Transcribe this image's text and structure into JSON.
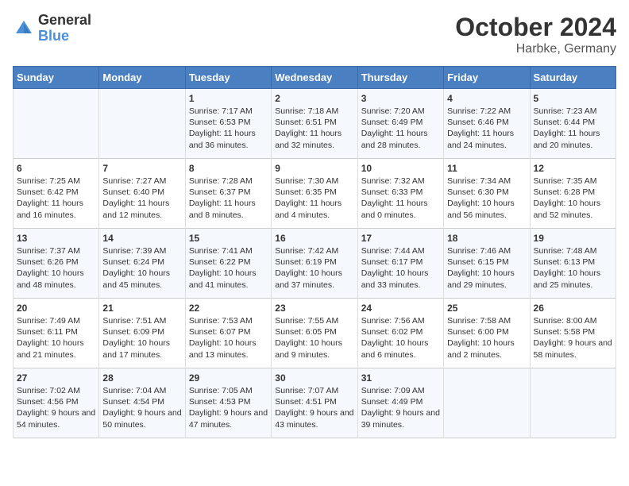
{
  "logo": {
    "general": "General",
    "blue": "Blue"
  },
  "title": "October 2024",
  "subtitle": "Harbke, Germany",
  "days_of_week": [
    "Sunday",
    "Monday",
    "Tuesday",
    "Wednesday",
    "Thursday",
    "Friday",
    "Saturday"
  ],
  "weeks": [
    [
      {
        "day": "",
        "sunrise": "",
        "sunset": "",
        "daylight": ""
      },
      {
        "day": "",
        "sunrise": "",
        "sunset": "",
        "daylight": ""
      },
      {
        "day": "1",
        "sunrise": "Sunrise: 7:17 AM",
        "sunset": "Sunset: 6:53 PM",
        "daylight": "Daylight: 11 hours and 36 minutes."
      },
      {
        "day": "2",
        "sunrise": "Sunrise: 7:18 AM",
        "sunset": "Sunset: 6:51 PM",
        "daylight": "Daylight: 11 hours and 32 minutes."
      },
      {
        "day": "3",
        "sunrise": "Sunrise: 7:20 AM",
        "sunset": "Sunset: 6:49 PM",
        "daylight": "Daylight: 11 hours and 28 minutes."
      },
      {
        "day": "4",
        "sunrise": "Sunrise: 7:22 AM",
        "sunset": "Sunset: 6:46 PM",
        "daylight": "Daylight: 11 hours and 24 minutes."
      },
      {
        "day": "5",
        "sunrise": "Sunrise: 7:23 AM",
        "sunset": "Sunset: 6:44 PM",
        "daylight": "Daylight: 11 hours and 20 minutes."
      }
    ],
    [
      {
        "day": "6",
        "sunrise": "Sunrise: 7:25 AM",
        "sunset": "Sunset: 6:42 PM",
        "daylight": "Daylight: 11 hours and 16 minutes."
      },
      {
        "day": "7",
        "sunrise": "Sunrise: 7:27 AM",
        "sunset": "Sunset: 6:40 PM",
        "daylight": "Daylight: 11 hours and 12 minutes."
      },
      {
        "day": "8",
        "sunrise": "Sunrise: 7:28 AM",
        "sunset": "Sunset: 6:37 PM",
        "daylight": "Daylight: 11 hours and 8 minutes."
      },
      {
        "day": "9",
        "sunrise": "Sunrise: 7:30 AM",
        "sunset": "Sunset: 6:35 PM",
        "daylight": "Daylight: 11 hours and 4 minutes."
      },
      {
        "day": "10",
        "sunrise": "Sunrise: 7:32 AM",
        "sunset": "Sunset: 6:33 PM",
        "daylight": "Daylight: 11 hours and 0 minutes."
      },
      {
        "day": "11",
        "sunrise": "Sunrise: 7:34 AM",
        "sunset": "Sunset: 6:30 PM",
        "daylight": "Daylight: 10 hours and 56 minutes."
      },
      {
        "day": "12",
        "sunrise": "Sunrise: 7:35 AM",
        "sunset": "Sunset: 6:28 PM",
        "daylight": "Daylight: 10 hours and 52 minutes."
      }
    ],
    [
      {
        "day": "13",
        "sunrise": "Sunrise: 7:37 AM",
        "sunset": "Sunset: 6:26 PM",
        "daylight": "Daylight: 10 hours and 48 minutes."
      },
      {
        "day": "14",
        "sunrise": "Sunrise: 7:39 AM",
        "sunset": "Sunset: 6:24 PM",
        "daylight": "Daylight: 10 hours and 45 minutes."
      },
      {
        "day": "15",
        "sunrise": "Sunrise: 7:41 AM",
        "sunset": "Sunset: 6:22 PM",
        "daylight": "Daylight: 10 hours and 41 minutes."
      },
      {
        "day": "16",
        "sunrise": "Sunrise: 7:42 AM",
        "sunset": "Sunset: 6:19 PM",
        "daylight": "Daylight: 10 hours and 37 minutes."
      },
      {
        "day": "17",
        "sunrise": "Sunrise: 7:44 AM",
        "sunset": "Sunset: 6:17 PM",
        "daylight": "Daylight: 10 hours and 33 minutes."
      },
      {
        "day": "18",
        "sunrise": "Sunrise: 7:46 AM",
        "sunset": "Sunset: 6:15 PM",
        "daylight": "Daylight: 10 hours and 29 minutes."
      },
      {
        "day": "19",
        "sunrise": "Sunrise: 7:48 AM",
        "sunset": "Sunset: 6:13 PM",
        "daylight": "Daylight: 10 hours and 25 minutes."
      }
    ],
    [
      {
        "day": "20",
        "sunrise": "Sunrise: 7:49 AM",
        "sunset": "Sunset: 6:11 PM",
        "daylight": "Daylight: 10 hours and 21 minutes."
      },
      {
        "day": "21",
        "sunrise": "Sunrise: 7:51 AM",
        "sunset": "Sunset: 6:09 PM",
        "daylight": "Daylight: 10 hours and 17 minutes."
      },
      {
        "day": "22",
        "sunrise": "Sunrise: 7:53 AM",
        "sunset": "Sunset: 6:07 PM",
        "daylight": "Daylight: 10 hours and 13 minutes."
      },
      {
        "day": "23",
        "sunrise": "Sunrise: 7:55 AM",
        "sunset": "Sunset: 6:05 PM",
        "daylight": "Daylight: 10 hours and 9 minutes."
      },
      {
        "day": "24",
        "sunrise": "Sunrise: 7:56 AM",
        "sunset": "Sunset: 6:02 PM",
        "daylight": "Daylight: 10 hours and 6 minutes."
      },
      {
        "day": "25",
        "sunrise": "Sunrise: 7:58 AM",
        "sunset": "Sunset: 6:00 PM",
        "daylight": "Daylight: 10 hours and 2 minutes."
      },
      {
        "day": "26",
        "sunrise": "Sunrise: 8:00 AM",
        "sunset": "Sunset: 5:58 PM",
        "daylight": "Daylight: 9 hours and 58 minutes."
      }
    ],
    [
      {
        "day": "27",
        "sunrise": "Sunrise: 7:02 AM",
        "sunset": "Sunset: 4:56 PM",
        "daylight": "Daylight: 9 hours and 54 minutes."
      },
      {
        "day": "28",
        "sunrise": "Sunrise: 7:04 AM",
        "sunset": "Sunset: 4:54 PM",
        "daylight": "Daylight: 9 hours and 50 minutes."
      },
      {
        "day": "29",
        "sunrise": "Sunrise: 7:05 AM",
        "sunset": "Sunset: 4:53 PM",
        "daylight": "Daylight: 9 hours and 47 minutes."
      },
      {
        "day": "30",
        "sunrise": "Sunrise: 7:07 AM",
        "sunset": "Sunset: 4:51 PM",
        "daylight": "Daylight: 9 hours and 43 minutes."
      },
      {
        "day": "31",
        "sunrise": "Sunrise: 7:09 AM",
        "sunset": "Sunset: 4:49 PM",
        "daylight": "Daylight: 9 hours and 39 minutes."
      },
      {
        "day": "",
        "sunrise": "",
        "sunset": "",
        "daylight": ""
      },
      {
        "day": "",
        "sunrise": "",
        "sunset": "",
        "daylight": ""
      }
    ]
  ]
}
